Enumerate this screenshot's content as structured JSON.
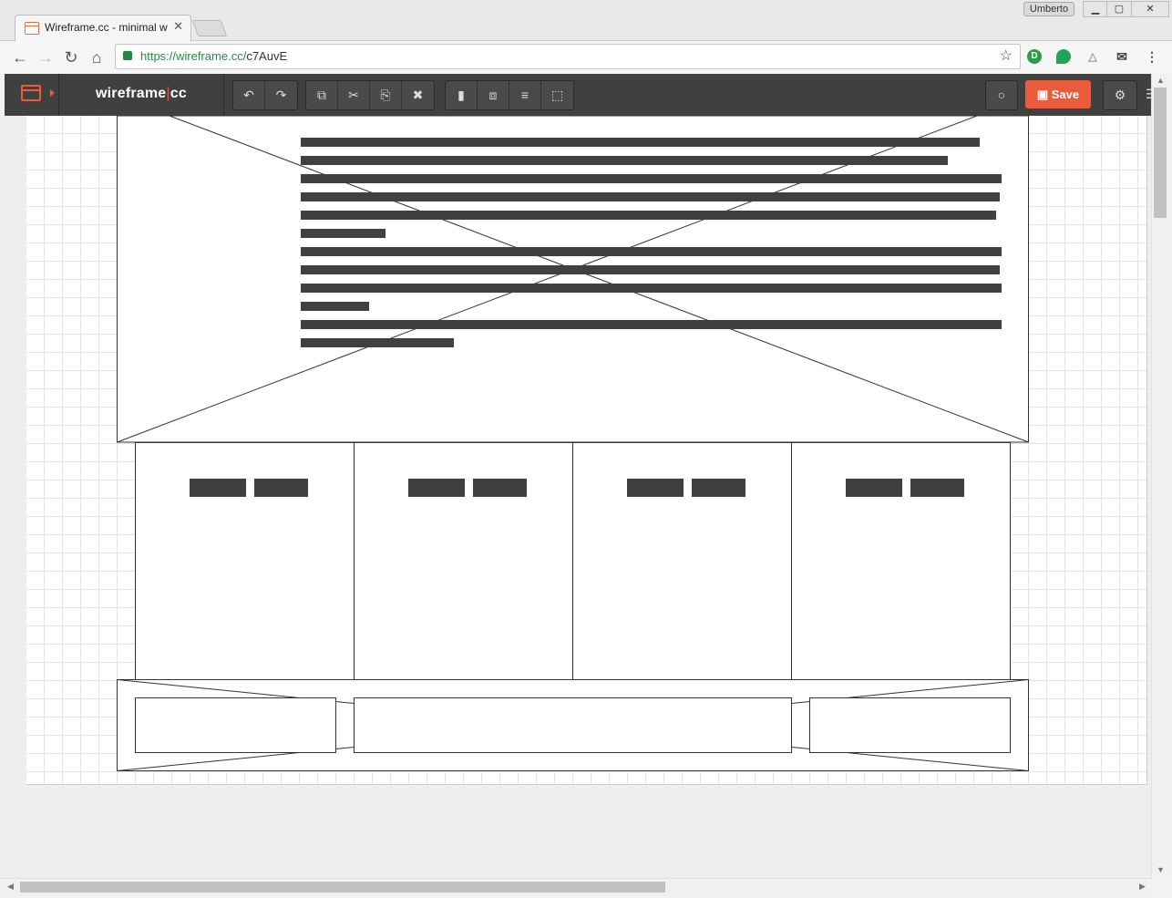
{
  "browser": {
    "tab_title": "Wireframe.cc - minimal w",
    "tab_close": "✕",
    "user_badge": "Umberto",
    "window_controls": {
      "minimize": "▁",
      "maximize": "▢",
      "close": "✕"
    },
    "url_host": "https://wireframe.cc/",
    "url_path": "c7AuvE",
    "nav": {
      "back": "←",
      "forward": "→",
      "reload": "↻",
      "home": "⌂"
    },
    "icons": [
      "back-icon",
      "forward-icon",
      "reload-icon",
      "home-icon",
      "lock-icon",
      "star-icon",
      "bell-icon",
      "mail-icon",
      "menu-icon"
    ],
    "star": "☆",
    "bell": "🔔",
    "mail": "✉",
    "more": "⋮"
  },
  "app": {
    "logo_left": "wireframe",
    "logo_sep": "|",
    "logo_right": "cc",
    "toolbar": {
      "undo": "↶",
      "redo": "↷",
      "copy": "⧉",
      "cut": "✂",
      "paste": "⎘",
      "delete": "✖",
      "lock": "🔒",
      "arrange": "⧈",
      "align": "≡",
      "group": "⬚"
    },
    "comment": "💬",
    "save_label": "Save",
    "save_icon": "💾",
    "settings": "⚙",
    "hamburger": "☰",
    "accent_color": "#e85b3c",
    "toolbar_color": "#404040"
  }
}
